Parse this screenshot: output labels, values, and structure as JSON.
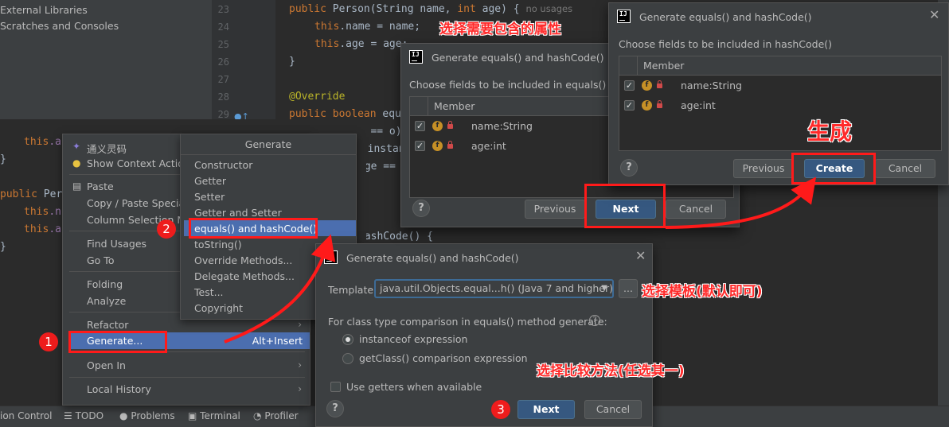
{
  "project_tree": {
    "items": [
      "External Libraries",
      "Scratches and Consoles"
    ]
  },
  "editor": {
    "line_numbers": [
      "23",
      "24",
      "25",
      "26",
      "27",
      "28",
      "29"
    ],
    "lines": {
      "l23_kw": "public",
      "l23_sig": "Person(String name, ",
      "l23_int": "int",
      "l23_rest": " age) {",
      "l23_hint": "no usages",
      "l24_this": "this",
      "l24_rest": ".name = name;",
      "l25_this": "this",
      "l25_rest": ".age = age;",
      "l26": "}",
      "l28": "@Override",
      "l29_kw": "public boolean",
      "l29_rest": " equals(Object o) {",
      "l30": "if (this == o)",
      "l31": "o instanceof",
      "l32": "age ==",
      "l_hash": "hashCode() {"
    },
    "left_lines": {
      "a1_this": "this",
      "a1_rest": ".a",
      "a2": "}",
      "a3_kw": "public",
      "a3_rest": " Per",
      "a4_this": "this",
      "a4_rest": ".n",
      "a5_this": "this",
      "a5_rest": ".a",
      "a6": "}"
    }
  },
  "context_menu": {
    "items": [
      "通义灵码",
      "Show Context Actions",
      "Paste",
      "Copy / Paste Special",
      "Column Selection Mode",
      "Find Usages",
      "Go To",
      "Folding",
      "Analyze",
      "Refactor",
      "Generate...",
      "Open In",
      "Local History"
    ],
    "generate_shortcut": "Alt+Insert"
  },
  "generate_menu": {
    "header": "Generate",
    "items": [
      "Constructor",
      "Getter",
      "Setter",
      "Getter and Setter",
      "equals() and hashCode()",
      "toString()",
      "Override Methods...",
      "Delegate Methods...",
      "Test...",
      "Copyright"
    ],
    "selected_index": 4
  },
  "dialog_template": {
    "title": "Generate equals() and hashCode()",
    "template_label": "Template:",
    "template_value": "java.util.Objects.equal...h() (Java 7 and higher)",
    "more_button": "...",
    "comparison_label": "For class type comparison in equals() method generate:",
    "options": [
      "instanceof expression",
      "getClass() comparison expression"
    ],
    "selected_option": 0,
    "getters_label": "Use getters when available",
    "next": "Next",
    "cancel": "Cancel"
  },
  "dialog_fields": {
    "title": "Generate equals() and hashCode()",
    "choose_label": "Choose fields to be included in equals()",
    "column": "Member",
    "fields": [
      "name:String",
      "age:int"
    ],
    "previous": "Previous",
    "next": "Next",
    "cancel": "Cancel"
  },
  "dialog_hash": {
    "title": "Generate equals() and hashCode()",
    "choose_label": "Choose fields to be included in hashCode()",
    "column": "Member",
    "fields": [
      "name:String",
      "age:int"
    ],
    "previous": "Previous",
    "create": "Create",
    "cancel": "Cancel"
  },
  "status_bar": {
    "items": [
      "ion Control",
      "TODO",
      "Problems",
      "Terminal",
      "Profiler"
    ]
  },
  "annotations": {
    "step1": "1",
    "step2": "2",
    "step3": "3",
    "fields_note": "选择需要包含的属性",
    "template_note": "选择模板(默认即可)",
    "method_note": "选择比较方法(任选其一)",
    "create_note": "生成"
  },
  "colors": {
    "annotation_red": "#ff1a1a",
    "selection_blue": "#4b6eaf",
    "primary_button": "#365880"
  }
}
